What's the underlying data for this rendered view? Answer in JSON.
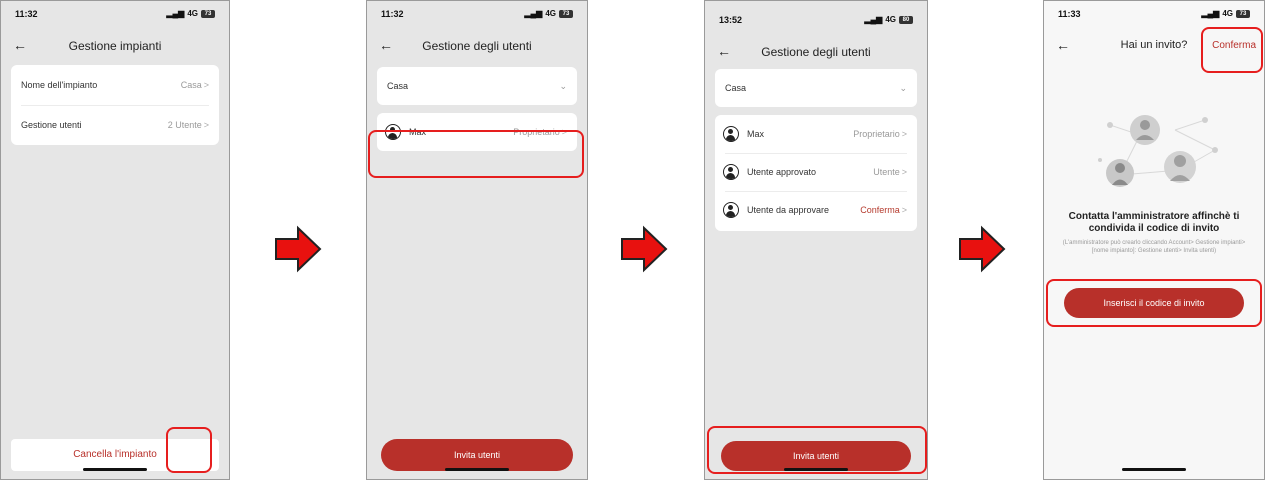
{
  "screen1": {
    "time": "11:32",
    "network": "4G",
    "battery": "73",
    "title": "Gestione impianti",
    "rows": [
      {
        "label": "Nome dell'impianto",
        "value": "Casa"
      },
      {
        "label": "Gestione utenti",
        "value": "2 Utente"
      }
    ],
    "delete_label": "Cancella l'impianto"
  },
  "screen2": {
    "time": "11:32",
    "network": "4G",
    "battery": "73",
    "title": "Gestione degli utenti",
    "dropdown_value": "Casa",
    "users": [
      {
        "name": "Max",
        "role": "Proprietario"
      }
    ],
    "invite_label": "Invita utenti"
  },
  "screen3": {
    "time": "13:52",
    "network": "4G",
    "battery": "80",
    "title": "Gestione degli utenti",
    "dropdown_value": "Casa",
    "users": [
      {
        "name": "Max",
        "role": "Proprietario"
      },
      {
        "name": "Utente approvato",
        "role": "Utente"
      },
      {
        "name": "Utente da approvare",
        "role": "Conferma"
      }
    ],
    "invite_label": "Invita utenti"
  },
  "screen4": {
    "time": "11:33",
    "network": "4G",
    "battery": "73",
    "title": "Hai un invito?",
    "confirm_label": "Conferma",
    "heading": "Contatta l'amministratore affinchè ti condivida il codice di invito",
    "note": "(L'amministratore può crearlo cliccando Account> Gestione impianti> [nome impianto]: Gestione utenti> Invita utenti)",
    "enter_code_label": "Inserisci il codice di invito"
  },
  "colors": {
    "accent": "#b8302a",
    "highlight": "#e61e1e",
    "arrow_fill": "#e8110f"
  }
}
